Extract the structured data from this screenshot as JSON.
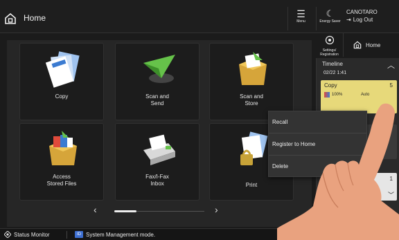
{
  "header": {
    "title": "Home",
    "menu_label": "Menu",
    "energy_label": "Energy Saver",
    "user_name": "CANOTARO",
    "logout_label": "Log Out"
  },
  "tiles": [
    {
      "label": "Copy",
      "icon": "copy-icon"
    },
    {
      "label": "Scan and\nSend",
      "icon": "scan-send-icon"
    },
    {
      "label": "Scan and\nStore",
      "icon": "scan-store-icon"
    },
    {
      "label": "Access\nStored Files",
      "icon": "stored-files-icon"
    },
    {
      "label": "Fax/I-Fax\nInbox",
      "icon": "fax-inbox-icon"
    },
    {
      "label": "Print",
      "icon": "print-icon"
    }
  ],
  "pager": {
    "prev": "‹",
    "next": "›"
  },
  "side": {
    "settings_label": "Settings/\nRegistration",
    "home_label": "Home"
  },
  "timeline": {
    "title": "Timeline",
    "time": "02/22 1:41",
    "job": {
      "name": "Copy",
      "count": "5",
      "zoom": "100%",
      "mode": "Auto"
    },
    "job3_count": "1"
  },
  "context_menu": {
    "items": [
      "Recall",
      "Register to Home",
      "Delete"
    ]
  },
  "statusbar": {
    "status_monitor": "Status Monitor",
    "message": "System Management mode.",
    "badge": "ID"
  },
  "colors": {
    "job_card": "#e7d97a",
    "id_badge": "#3d6fd1",
    "background": "#1b1b1b"
  }
}
